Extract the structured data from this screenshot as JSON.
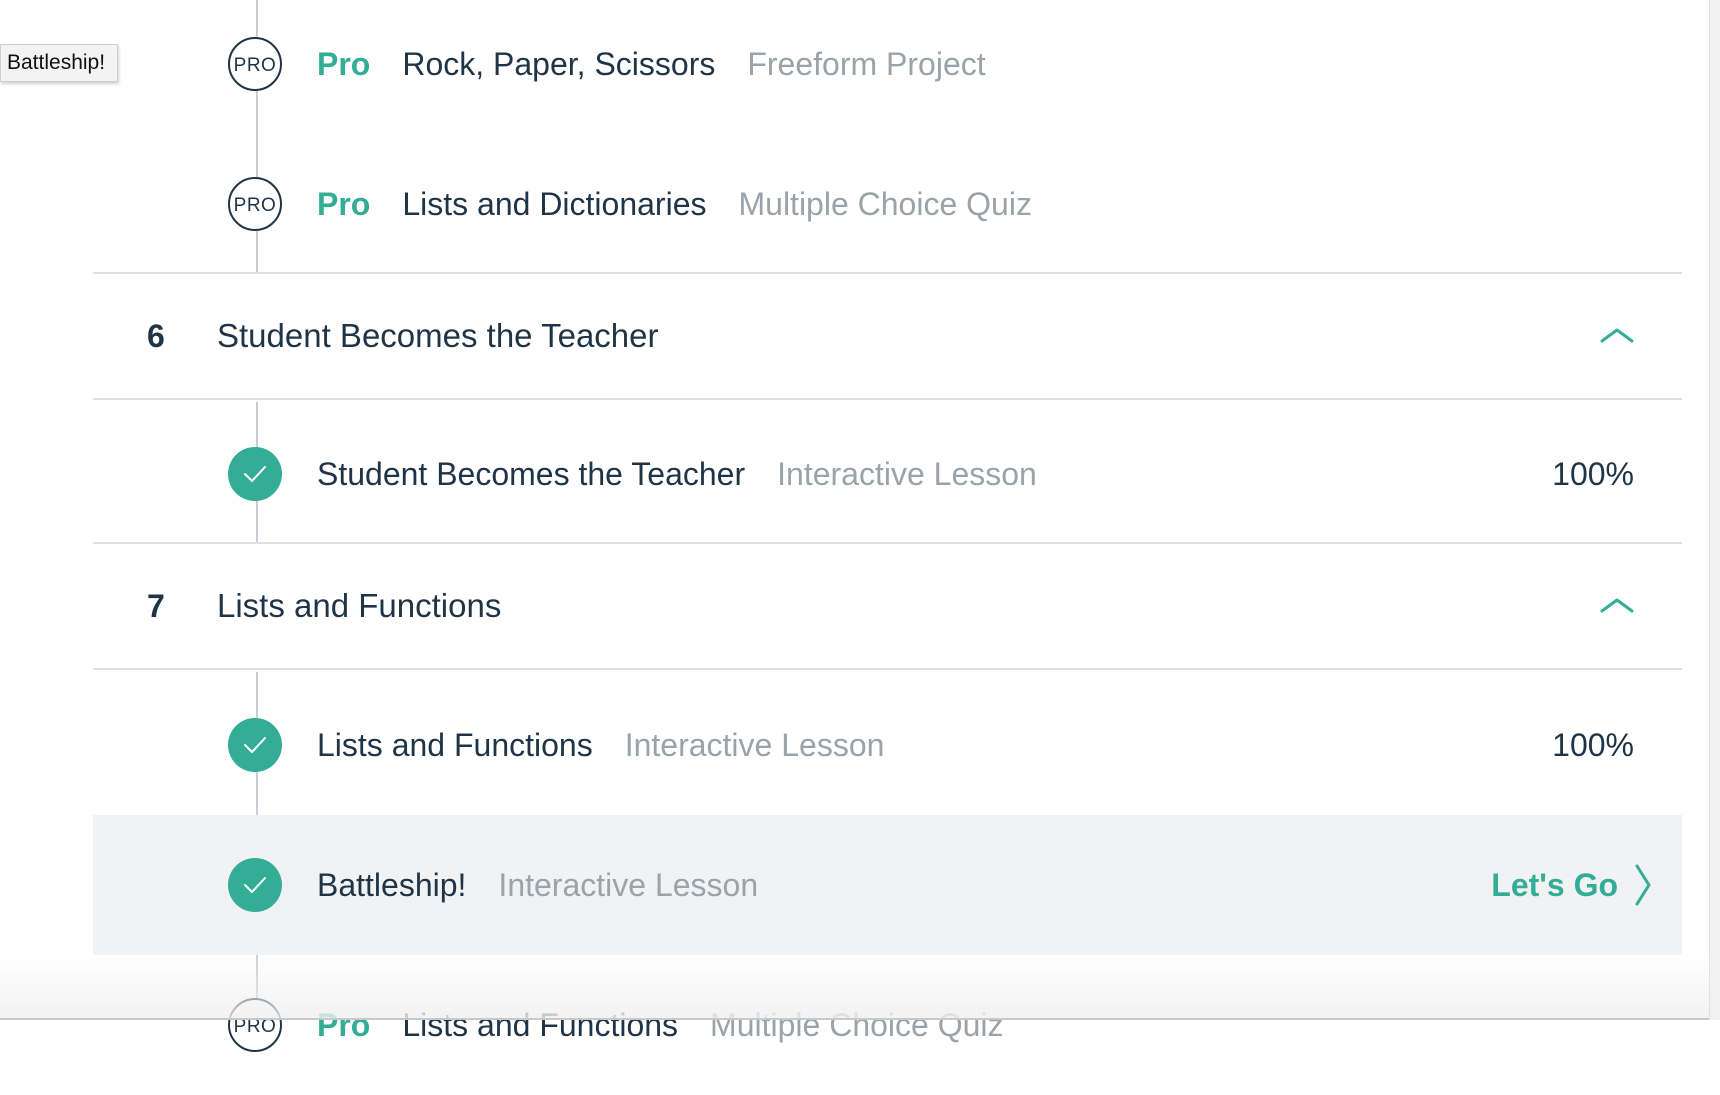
{
  "tooltip": {
    "text": "Battleship!"
  },
  "sections": [
    {
      "lessons": [
        {
          "pro_label": "Pro",
          "badge": "PRO",
          "title": "Rock, Paper, Scissors",
          "type": "Freeform Project"
        },
        {
          "pro_label": "Pro",
          "badge": "PRO",
          "title": "Lists and Dictionaries",
          "type": "Multiple Choice Quiz"
        }
      ]
    },
    {
      "number": "6",
      "title": "Student Becomes the Teacher",
      "lessons": [
        {
          "title": "Student Becomes the Teacher",
          "type": "Interactive Lesson",
          "progress": "100%"
        }
      ]
    },
    {
      "number": "7",
      "title": "Lists and Functions",
      "lessons": [
        {
          "title": "Lists and Functions",
          "type": "Interactive Lesson",
          "progress": "100%"
        },
        {
          "title": "Battleship!",
          "type": "Interactive Lesson",
          "cta": "Let's Go"
        },
        {
          "pro_label": "Pro",
          "badge": "PRO",
          "title": "Lists and Functions",
          "type": "Multiple Choice Quiz"
        }
      ]
    }
  ],
  "colors": {
    "accent": "#34ad96",
    "text": "#1f3447",
    "muted": "#9aa3a9",
    "highlight": "#f1f2f3",
    "divider": "#dde1e4"
  },
  "icons": {
    "complete": "checkmark-icon",
    "collapse": "chevron-up-icon",
    "go": "chevron-right-icon"
  }
}
